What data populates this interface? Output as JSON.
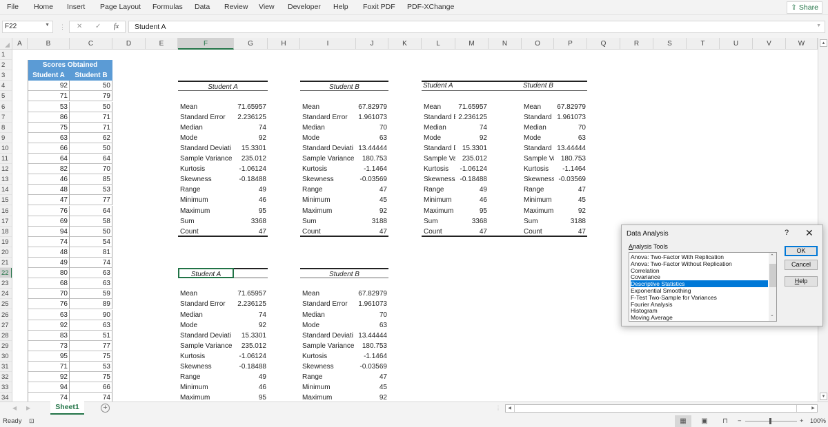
{
  "menu": {
    "items": [
      "File",
      "Home",
      "Insert",
      "Page Layout",
      "Formulas",
      "Data",
      "Review",
      "View",
      "Developer",
      "Help",
      "Foxit PDF",
      "PDF-XChange"
    ],
    "share_label": "Share",
    "share_icon": "share-icon"
  },
  "formula_bar": {
    "name_box": "F22",
    "cancel_icon": "✕",
    "enter_icon": "✓",
    "fx_icon": "fx",
    "content": "Student A"
  },
  "sheet": {
    "selected_cell": "F22",
    "columns": [
      "A",
      "B",
      "C",
      "D",
      "E",
      "F",
      "G",
      "H",
      "I",
      "J",
      "K",
      "L",
      "M",
      "N",
      "O",
      "P",
      "Q",
      "R",
      "S",
      "T",
      "U",
      "V",
      "W"
    ],
    "rows": [
      1,
      2,
      3,
      4,
      5,
      6,
      7,
      8,
      9,
      10,
      11,
      12,
      13,
      14,
      15,
      16,
      17,
      18,
      19,
      20,
      21,
      22,
      23,
      24,
      25,
      26,
      27,
      28,
      29,
      30,
      31,
      32,
      33,
      34
    ],
    "scores_table": {
      "title": "Scores Obtained",
      "headers": [
        "Student A",
        "Student B"
      ],
      "student_a": [
        92,
        71,
        53,
        86,
        75,
        63,
        66,
        64,
        82,
        46,
        48,
        47,
        76,
        69,
        94,
        74,
        48,
        49,
        80,
        68,
        70,
        76,
        63,
        92,
        83,
        73,
        95,
        71,
        92,
        94,
        74
      ],
      "student_b": [
        50,
        79,
        50,
        71,
        71,
        62,
        50,
        64,
        70,
        85,
        53,
        77,
        64,
        58,
        50,
        54,
        81,
        74,
        63,
        63,
        59,
        89,
        90,
        63,
        51,
        77,
        75,
        53,
        75,
        66,
        74
      ]
    },
    "stats_labels_full": [
      "Mean",
      "Standard Error",
      "Median",
      "Mode",
      "Standard Deviati",
      "Sample Variance",
      "Kurtosis",
      "Skewness",
      "Range",
      "Minimum",
      "Maximum",
      "Sum",
      "Count"
    ],
    "stats_labels_truncated": [
      "Mean",
      "Standard E",
      "Median",
      "Mode",
      "Standard D",
      "Sample Va",
      "Kurtosis",
      "Skewness",
      "Range",
      "Minimum",
      "Maximum",
      "Sum",
      "Count"
    ],
    "stats_a": [
      "71.65957",
      "2.236125",
      "74",
      "92",
      "15.3301",
      "235.012",
      "-1.06124",
      "-0.18488",
      "49",
      "46",
      "95",
      "3368",
      "47"
    ],
    "stats_b": [
      "67.82979",
      "1.961073",
      "70",
      "63",
      "13.44444",
      "180.753",
      "-1.1464",
      "-0.03569",
      "47",
      "45",
      "92",
      "3188",
      "47"
    ],
    "header_a": "Student A",
    "header_b": "Student B"
  },
  "tabs": {
    "sheets": [
      "Sheet1"
    ],
    "active": "Sheet1",
    "add_label": "+"
  },
  "status": {
    "ready": "Ready",
    "zoom": "100%",
    "zoom_minus": "−",
    "zoom_plus": "+"
  },
  "dialog": {
    "title": "Data Analysis",
    "help_icon": "?",
    "close_icon": "✕",
    "list_label": "Analysis Tools",
    "tools": [
      "Anova: Two-Factor With Replication",
      "Anova: Two-Factor Without Replication",
      "Correlation",
      "Covariance",
      "Descriptive Statistics",
      "Exponential Smoothing",
      "F-Test Two-Sample for Variances",
      "Fourier Analysis",
      "Histogram",
      "Moving Average"
    ],
    "selected_tool": "Descriptive Statistics",
    "ok_label": "OK",
    "cancel_label": "Cancel",
    "help_label": "Help"
  }
}
